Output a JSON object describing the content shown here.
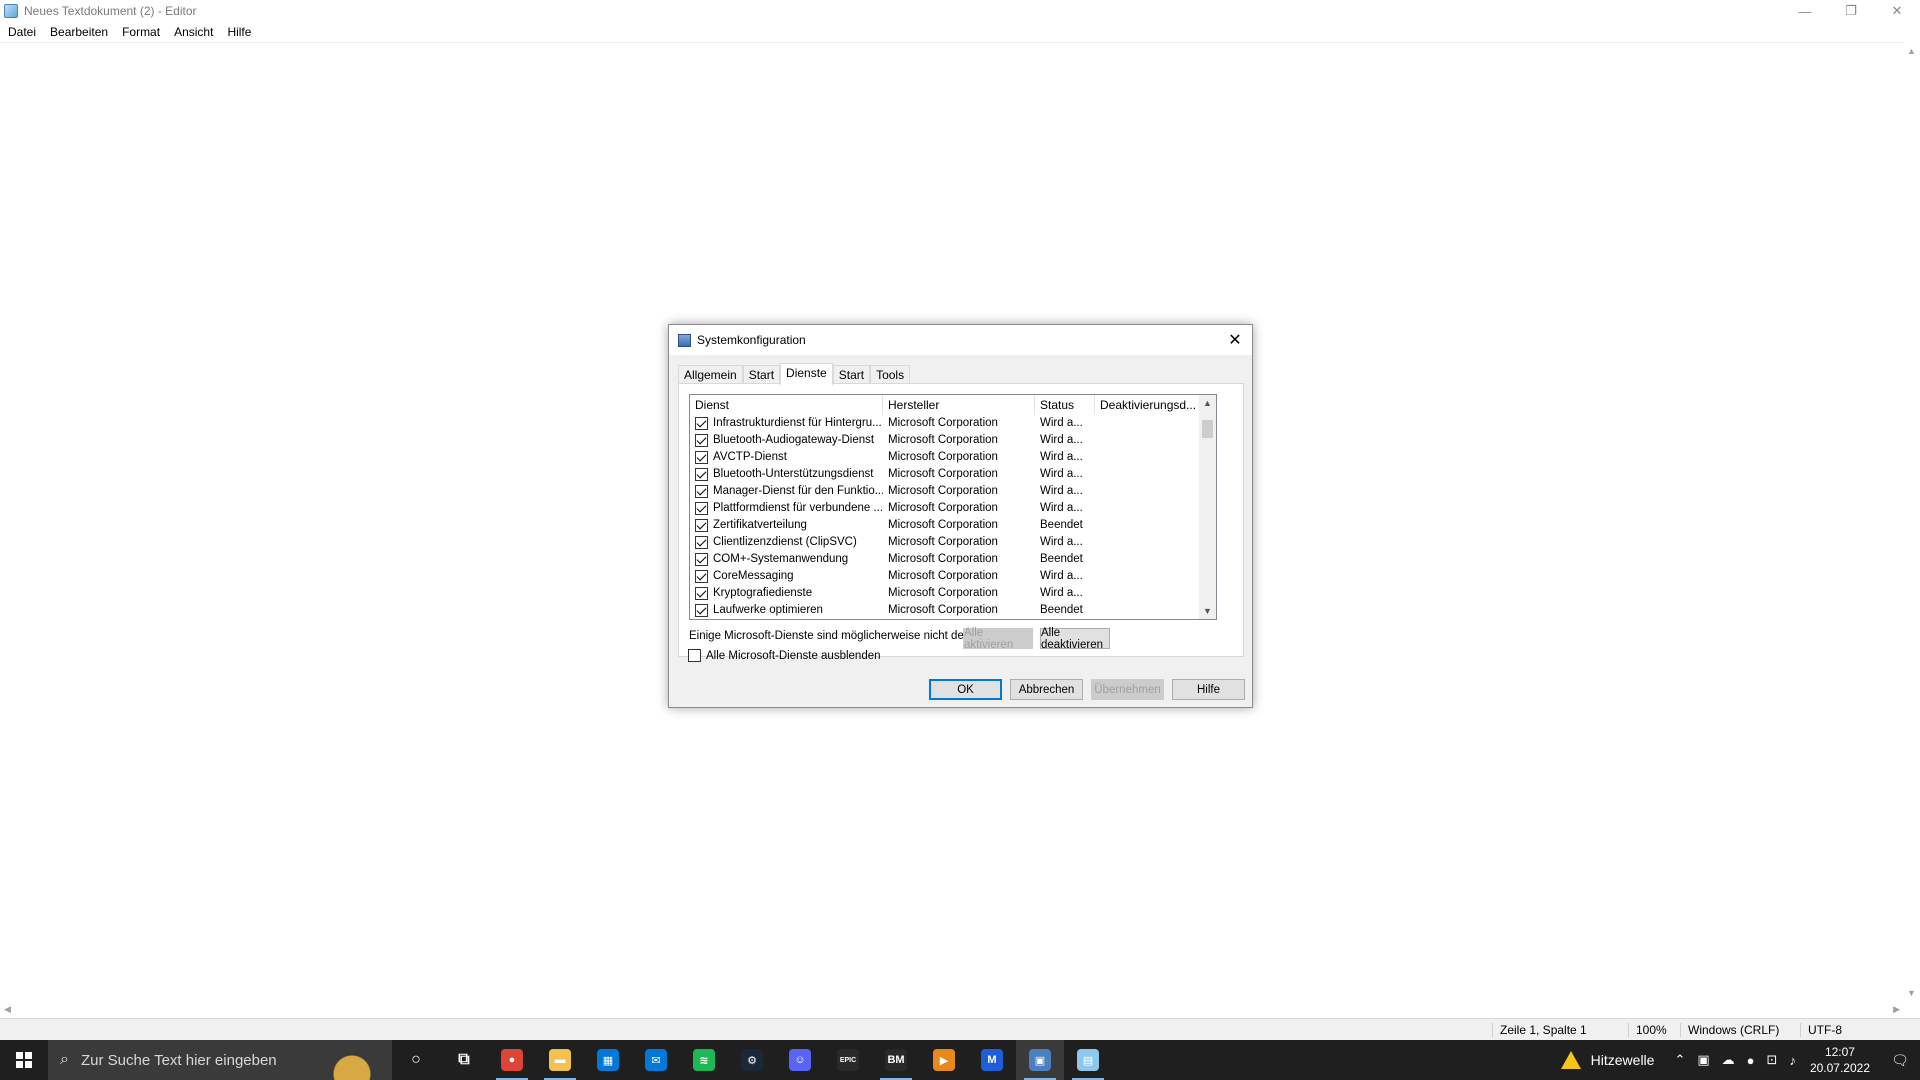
{
  "window": {
    "title": "Neues Textdokument (2) - Editor",
    "controls": {
      "minimize": "—",
      "restore": "❐",
      "close": "✕"
    }
  },
  "menu": [
    "Datei",
    "Bearbeiten",
    "Format",
    "Ansicht",
    "Hilfe"
  ],
  "statusbar": {
    "position": "Zeile 1, Spalte 1",
    "zoom": "100%",
    "line_ending": "Windows (CRLF)",
    "encoding": "UTF-8"
  },
  "dialog": {
    "title": "Systemkonfiguration",
    "tabs": [
      {
        "label": "Allgemein",
        "active": false
      },
      {
        "label": "Start",
        "active": false
      },
      {
        "label": "Dienste",
        "active": true
      },
      {
        "label": "Start",
        "active": false
      },
      {
        "label": "Tools",
        "active": false
      }
    ],
    "columns": [
      "Dienst",
      "Hersteller",
      "Status",
      "Deaktivierungsd..."
    ],
    "rows": [
      {
        "service": "Infrastrukturdienst für Hintergru...",
        "vendor": "Microsoft Corporation",
        "status": "Wird a...",
        "checked": true
      },
      {
        "service": "Bluetooth-Audiogateway-Dienst",
        "vendor": "Microsoft Corporation",
        "status": "Wird a...",
        "checked": true
      },
      {
        "service": "AVCTP-Dienst",
        "vendor": "Microsoft Corporation",
        "status": "Wird a...",
        "checked": true
      },
      {
        "service": "Bluetooth-Unterstützungsdienst",
        "vendor": "Microsoft Corporation",
        "status": "Wird a...",
        "checked": true
      },
      {
        "service": "Manager-Dienst für den Funktio...",
        "vendor": "Microsoft Corporation",
        "status": "Wird a...",
        "checked": true
      },
      {
        "service": "Plattformdienst für verbundene ...",
        "vendor": "Microsoft Corporation",
        "status": "Wird a...",
        "checked": true
      },
      {
        "service": "Zertifikatverteilung",
        "vendor": "Microsoft Corporation",
        "status": "Beendet",
        "checked": true
      },
      {
        "service": "Clientlizenzdienst (ClipSVC)",
        "vendor": "Microsoft Corporation",
        "status": "Wird a...",
        "checked": true
      },
      {
        "service": "COM+-Systemanwendung",
        "vendor": "Microsoft Corporation",
        "status": "Beendet",
        "checked": true
      },
      {
        "service": "CoreMessaging",
        "vendor": "Microsoft Corporation",
        "status": "Wird a...",
        "checked": true
      },
      {
        "service": "Kryptografiedienste",
        "vendor": "Microsoft Corporation",
        "status": "Wird a...",
        "checked": true
      },
      {
        "service": "Laufwerke optimieren",
        "vendor": "Microsoft Corporation",
        "status": "Beendet",
        "checked": true
      }
    ],
    "note": "Einige Microsoft-Dienste sind möglicherweise nicht deaktiviert.",
    "enable_all": "Alle aktivieren",
    "disable_all": "Alle deaktivieren",
    "hide_ms_label": "Alle Microsoft-Dienste ausblenden",
    "hide_ms_checked": false,
    "ok": "OK",
    "cancel": "Abbrechen",
    "apply": "Übernehmen",
    "help": "Hilfe",
    "close": "✕"
  },
  "taskbar": {
    "search_placeholder": "Zur Suche Text hier eingeben",
    "apps": [
      {
        "name": "cortana-icon",
        "glyph": "○",
        "color": ""
      },
      {
        "name": "task-view-icon",
        "glyph": "⧉",
        "color": ""
      },
      {
        "name": "chrome-icon",
        "glyph": "●",
        "color": "#db4437",
        "active": true
      },
      {
        "name": "file-explorer-icon",
        "glyph": "▬",
        "color": "#f2c14e",
        "active": true
      },
      {
        "name": "store-icon",
        "glyph": "▦",
        "color": "#0078d7"
      },
      {
        "name": "mail-icon",
        "glyph": "✉",
        "color": "#0078d7"
      },
      {
        "name": "spotify-icon",
        "glyph": "≋",
        "color": "#1db954"
      },
      {
        "name": "steam-icon",
        "glyph": "⚙",
        "color": "#1b2838"
      },
      {
        "name": "discord-icon",
        "glyph": "☺",
        "color": "#5865f2"
      },
      {
        "name": "epic-games-icon",
        "glyph": "EPIC",
        "color": "#2a2a2a"
      },
      {
        "name": "bm-app-icon",
        "glyph": "BM",
        "color": "#2a2a2a",
        "active": true
      },
      {
        "name": "media-player-icon",
        "glyph": "▶",
        "color": "#e8891b"
      },
      {
        "name": "malwarebytes-icon",
        "glyph": "M",
        "color": "#1e5ed8"
      },
      {
        "name": "msconfig-icon",
        "glyph": "▣",
        "color": "#4a7fc0",
        "active": true,
        "focused": true
      },
      {
        "name": "notepad-icon",
        "glyph": "▤",
        "color": "#8fc7ec",
        "active": true
      }
    ],
    "weather": "Hitzewelle",
    "time": "12:07",
    "date": "20.07.2022"
  }
}
